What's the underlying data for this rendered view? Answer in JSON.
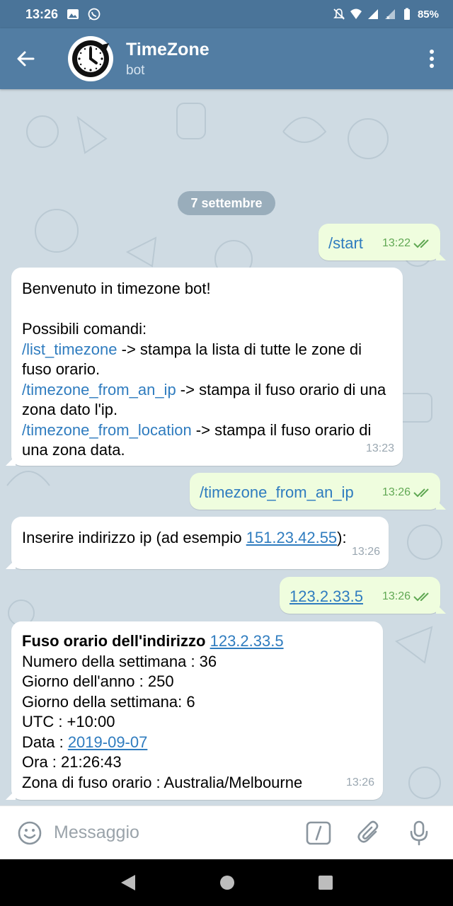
{
  "status_bar": {
    "time": "13:26",
    "battery": "85%",
    "icons": [
      "image-icon",
      "whatsapp-icon",
      "mute-icon",
      "wifi-icon",
      "signal-icon",
      "signal-icon",
      "battery-icon"
    ]
  },
  "header": {
    "title": "TimeZone",
    "subtitle": "bot",
    "avatar_icon": "clock-icon"
  },
  "chat": {
    "date_divider": "7 settembre",
    "messages": [
      {
        "direction": "out",
        "text": "/start",
        "time": "13:22",
        "status": "read"
      },
      {
        "direction": "in",
        "line1": "Benvenuto in timezone bot!",
        "line2": "Possibili comandi:",
        "cmd1": "/list_timezone",
        "cmd1_desc": " -> stampa la lista di tutte le zone di fuso orario.",
        "cmd2": "/timezone_from_an_ip",
        "cmd2_desc": " -> stampa il fuso orario di una zona dato l'ip.",
        "cmd3": "/timezone_from_location",
        "cmd3_desc": " -> stampa il fuso orario di una zona data.",
        "time": "13:23"
      },
      {
        "direction": "out",
        "text": "/timezone_from_an_ip",
        "time": "13:26",
        "status": "read"
      },
      {
        "direction": "in",
        "prefix": "Inserire indirizzo ip (ad esempio ",
        "link": "151.23.42.55",
        "suffix": "):",
        "time": "13:26"
      },
      {
        "direction": "out",
        "text": "123.2.33.5",
        "time": "13:26",
        "status": "read"
      },
      {
        "direction": "in",
        "heading": "Fuso orario dell'indirizzo ",
        "heading_link": "123.2.33.5",
        "l1": "Numero della settimana : 36",
        "l2": "Giorno dell'anno : 250",
        "l3": "Giorno della settimana: 6",
        "l4": "UTC : +10:00",
        "l5_prefix": "Data : ",
        "l5_link": "2019-09-07",
        "l6": "Ora : 21:26:43",
        "l7": "Zona di fuso orario : Australia/Melbourne",
        "time": "13:26"
      }
    ]
  },
  "input": {
    "placeholder": "Messaggio"
  },
  "colors": {
    "header": "#527da3",
    "status_bar": "#4a7499",
    "chat_bg": "#cfdbe3",
    "out_bubble": "#effdde",
    "link": "#2f7cbf",
    "check": "#60a853"
  }
}
